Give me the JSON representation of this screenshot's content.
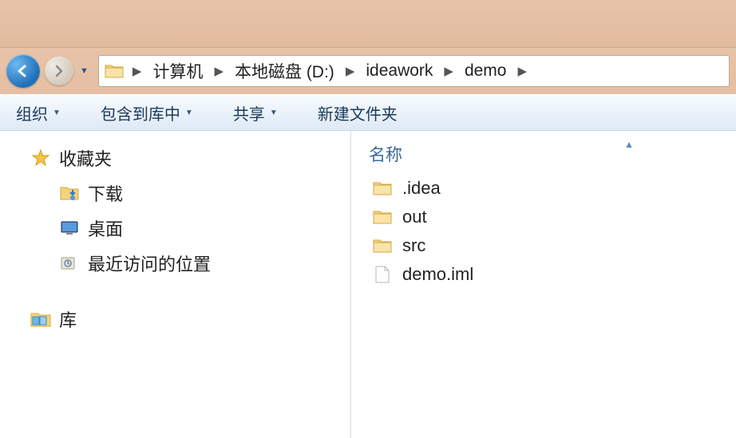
{
  "breadcrumb": {
    "items": [
      {
        "label": "计算机"
      },
      {
        "label": "本地磁盘 (D:)"
      },
      {
        "label": "ideawork"
      },
      {
        "label": "demo"
      }
    ]
  },
  "toolbar": {
    "organize": "组织",
    "include_in_library": "包含到库中",
    "share": "共享",
    "new_folder": "新建文件夹"
  },
  "sidebar": {
    "favorites": "收藏夹",
    "downloads": "下载",
    "desktop": "桌面",
    "recent": "最近访问的位置",
    "libraries": "库"
  },
  "content": {
    "column_name": "名称",
    "items": [
      {
        "name": ".idea",
        "type": "folder"
      },
      {
        "name": "out",
        "type": "folder"
      },
      {
        "name": "src",
        "type": "folder"
      },
      {
        "name": "demo.iml",
        "type": "file"
      }
    ]
  }
}
